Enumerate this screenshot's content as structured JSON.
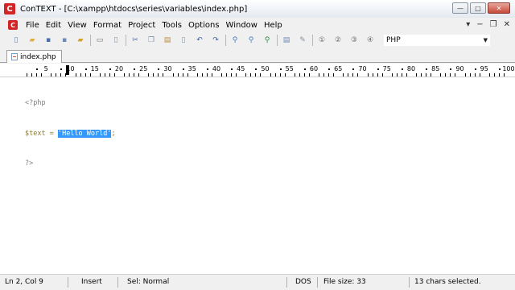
{
  "window": {
    "app_icon_letter": "C",
    "title": "ConTEXT - [C:\\xampp\\htdocs\\series\\variables\\index.php]",
    "controls": [
      "—",
      "□",
      "✕"
    ]
  },
  "menubar": {
    "items": [
      {
        "label": "File",
        "name": "menu-file"
      },
      {
        "label": "Edit",
        "name": "menu-edit"
      },
      {
        "label": "View",
        "name": "menu-view"
      },
      {
        "label": "Format",
        "name": "menu-format"
      },
      {
        "label": "Project",
        "name": "menu-project"
      },
      {
        "label": "Tools",
        "name": "menu-tools"
      },
      {
        "label": "Options",
        "name": "menu-options"
      },
      {
        "label": "Window",
        "name": "menu-window"
      },
      {
        "label": "Help",
        "name": "menu-help"
      }
    ],
    "mdi_controls": [
      "▾",
      "−",
      "❐",
      "✕"
    ]
  },
  "toolbar": {
    "language": "PHP",
    "groups": [
      [
        {
          "icon": "new-file-icon",
          "glyph": "▯",
          "color": "#5a7fb0"
        },
        {
          "icon": "open-folder-icon",
          "glyph": "▰",
          "color": "#e0b040"
        },
        {
          "icon": "save-icon",
          "glyph": "▪",
          "color": "#4a6ea8"
        },
        {
          "icon": "save-all-icon",
          "glyph": "▪",
          "color": "#6a8ab8"
        },
        {
          "icon": "open-project-icon",
          "glyph": "▰",
          "color": "#d6a02a"
        }
      ],
      [
        {
          "icon": "print-icon",
          "glyph": "▭",
          "color": "#707070"
        },
        {
          "icon": "print-preview-icon",
          "glyph": "▯",
          "color": "#8090a0"
        }
      ],
      [
        {
          "icon": "cut-icon",
          "glyph": "✂",
          "color": "#4a6ea8"
        },
        {
          "icon": "copy-icon",
          "glyph": "❐",
          "color": "#8090a0"
        },
        {
          "icon": "paste-icon",
          "glyph": "▤",
          "color": "#c08a3a"
        },
        {
          "icon": "delete-icon",
          "glyph": "▯",
          "color": "#8090a0"
        },
        {
          "icon": "undo-icon",
          "glyph": "↶",
          "color": "#3a60a8"
        },
        {
          "icon": "redo-icon",
          "glyph": "↷",
          "color": "#3a60a8"
        }
      ],
      [
        {
          "icon": "find-icon",
          "glyph": "⚲",
          "color": "#4a7ab8"
        },
        {
          "icon": "find-next-icon",
          "glyph": "⚲",
          "color": "#4a7ab8"
        },
        {
          "icon": "replace-icon",
          "glyph": "⚲",
          "color": "#2a8a4a"
        }
      ],
      [
        {
          "icon": "file-properties-icon",
          "glyph": "▤",
          "color": "#6a8ab8"
        },
        {
          "icon": "tools-icon",
          "glyph": "✎",
          "color": "#8090a0"
        }
      ],
      [
        {
          "icon": "user-command-1-icon",
          "glyph": "①",
          "color": "#6a6a6a"
        },
        {
          "icon": "user-command-2-icon",
          "glyph": "②",
          "color": "#6a6a6a"
        },
        {
          "icon": "user-command-3-icon",
          "glyph": "③",
          "color": "#6a6a6a"
        },
        {
          "icon": "user-command-4-icon",
          "glyph": "④",
          "color": "#6a6a6a"
        }
      ]
    ]
  },
  "tabs": [
    {
      "label": "index.php"
    }
  ],
  "ruler": {
    "labels": [
      "5",
      "10",
      "15",
      "20",
      "25",
      "30",
      "35",
      "40",
      "45",
      "50",
      "55",
      "60",
      "65",
      "70",
      "75",
      "80",
      "85",
      "90",
      "95",
      "100"
    ]
  },
  "editor": {
    "line1": "<?php",
    "line2_var": "$text",
    "line2_op": " = ",
    "line2_str": "'Hello World'",
    "line2_semi": ";",
    "line3": "?>"
  },
  "status": {
    "position": "Ln 2, Col 9",
    "mode": "Insert",
    "selection_mode": "Sel: Normal",
    "line_endings": "DOS",
    "file_size": "File size: 33",
    "selection_info": "13 chars selected."
  }
}
